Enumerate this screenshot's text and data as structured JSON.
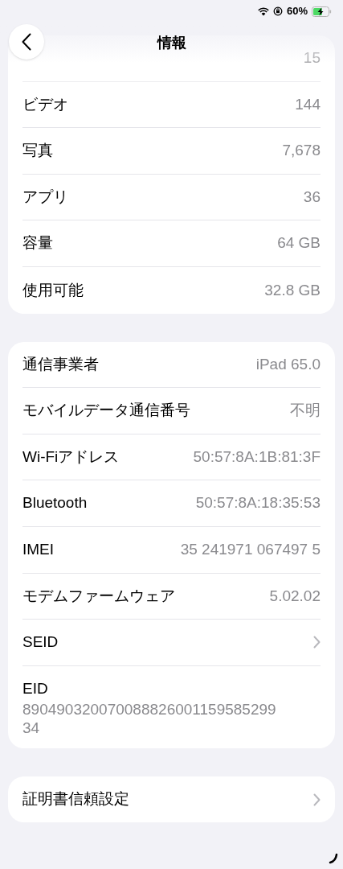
{
  "status_bar": {
    "battery_text": "60%",
    "charging": true
  },
  "nav": {
    "title": "情報"
  },
  "sections": [
    {
      "rows": [
        {
          "kind": "value",
          "faded": true,
          "value": "15"
        },
        {
          "kind": "value",
          "faded": false,
          "label": "ビデオ",
          "value": "144"
        },
        {
          "kind": "value",
          "faded": false,
          "label": "写真",
          "value": "7,678"
        },
        {
          "kind": "value",
          "faded": false,
          "label": "アプリ",
          "value": "36"
        },
        {
          "kind": "value",
          "faded": false,
          "label": "容量",
          "value": "64 GB"
        },
        {
          "kind": "value",
          "faded": false,
          "label": "使用可能",
          "value": "32.8 GB"
        }
      ]
    },
    {
      "rows": [
        {
          "kind": "value",
          "faded": false,
          "label": "通信事業者",
          "value": "iPad 65.0"
        },
        {
          "kind": "value",
          "faded": false,
          "label": "モバイルデータ通信番号",
          "value": "不明"
        },
        {
          "kind": "value",
          "faded": false,
          "label": "Wi-Fiアドレス",
          "value": "50:57:8A:1B:81:3F"
        },
        {
          "kind": "value",
          "faded": false,
          "label": "Bluetooth",
          "value": "50:57:8A:18:35:53"
        },
        {
          "kind": "value",
          "faded": false,
          "label": "IMEI",
          "value": "35 241971 067497 5"
        },
        {
          "kind": "value",
          "faded": false,
          "label": "モデムファームウェア",
          "value": "5.02.02"
        },
        {
          "kind": "link",
          "faded": false,
          "label": "SEID"
        },
        {
          "kind": "stacked",
          "faded": false,
          "label": "EID",
          "value_lines": [
            "890490320070088826001159585299",
            "34"
          ]
        }
      ]
    },
    {
      "rows": [
        {
          "kind": "link",
          "faded": false,
          "label": "証明書信頼設定"
        }
      ]
    }
  ]
}
